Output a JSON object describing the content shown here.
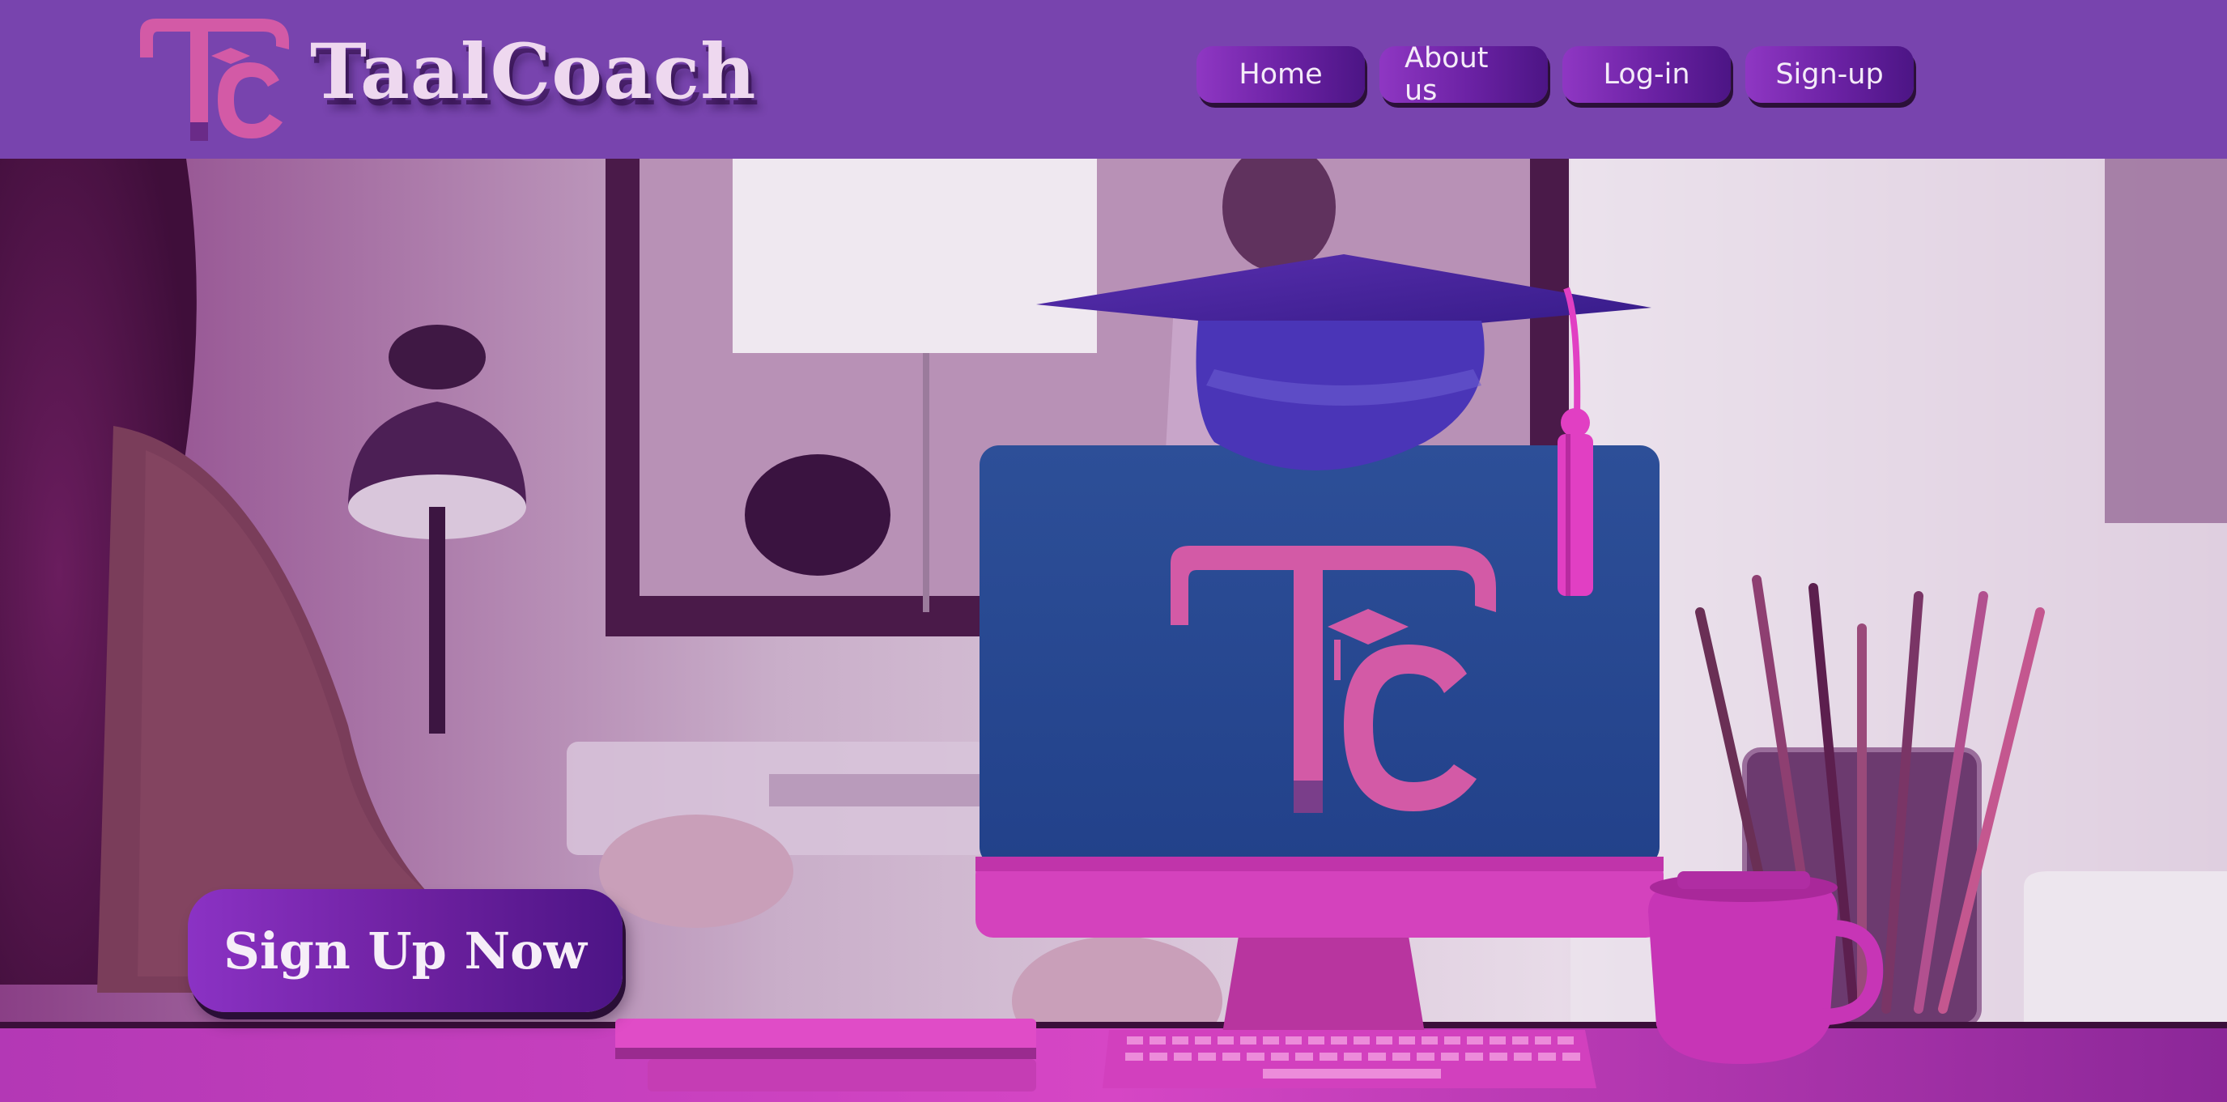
{
  "header": {
    "brand_name": "TaalCoach",
    "logo_icon": "taalcoach-tc-logo-icon",
    "nav": {
      "home": "Home",
      "about": "About us",
      "login": "Log-in",
      "signup": "Sign-up"
    }
  },
  "hero": {
    "cta_label": "Sign Up Now",
    "image_icon": "hero-study-desk-illustration"
  },
  "colors": {
    "header_bg": "#7844ae",
    "button_purple": "#6c209f",
    "brand_pink": "#d35aa6",
    "monitor_blue": "#2a4c93",
    "magenta": "#d53fc0"
  }
}
